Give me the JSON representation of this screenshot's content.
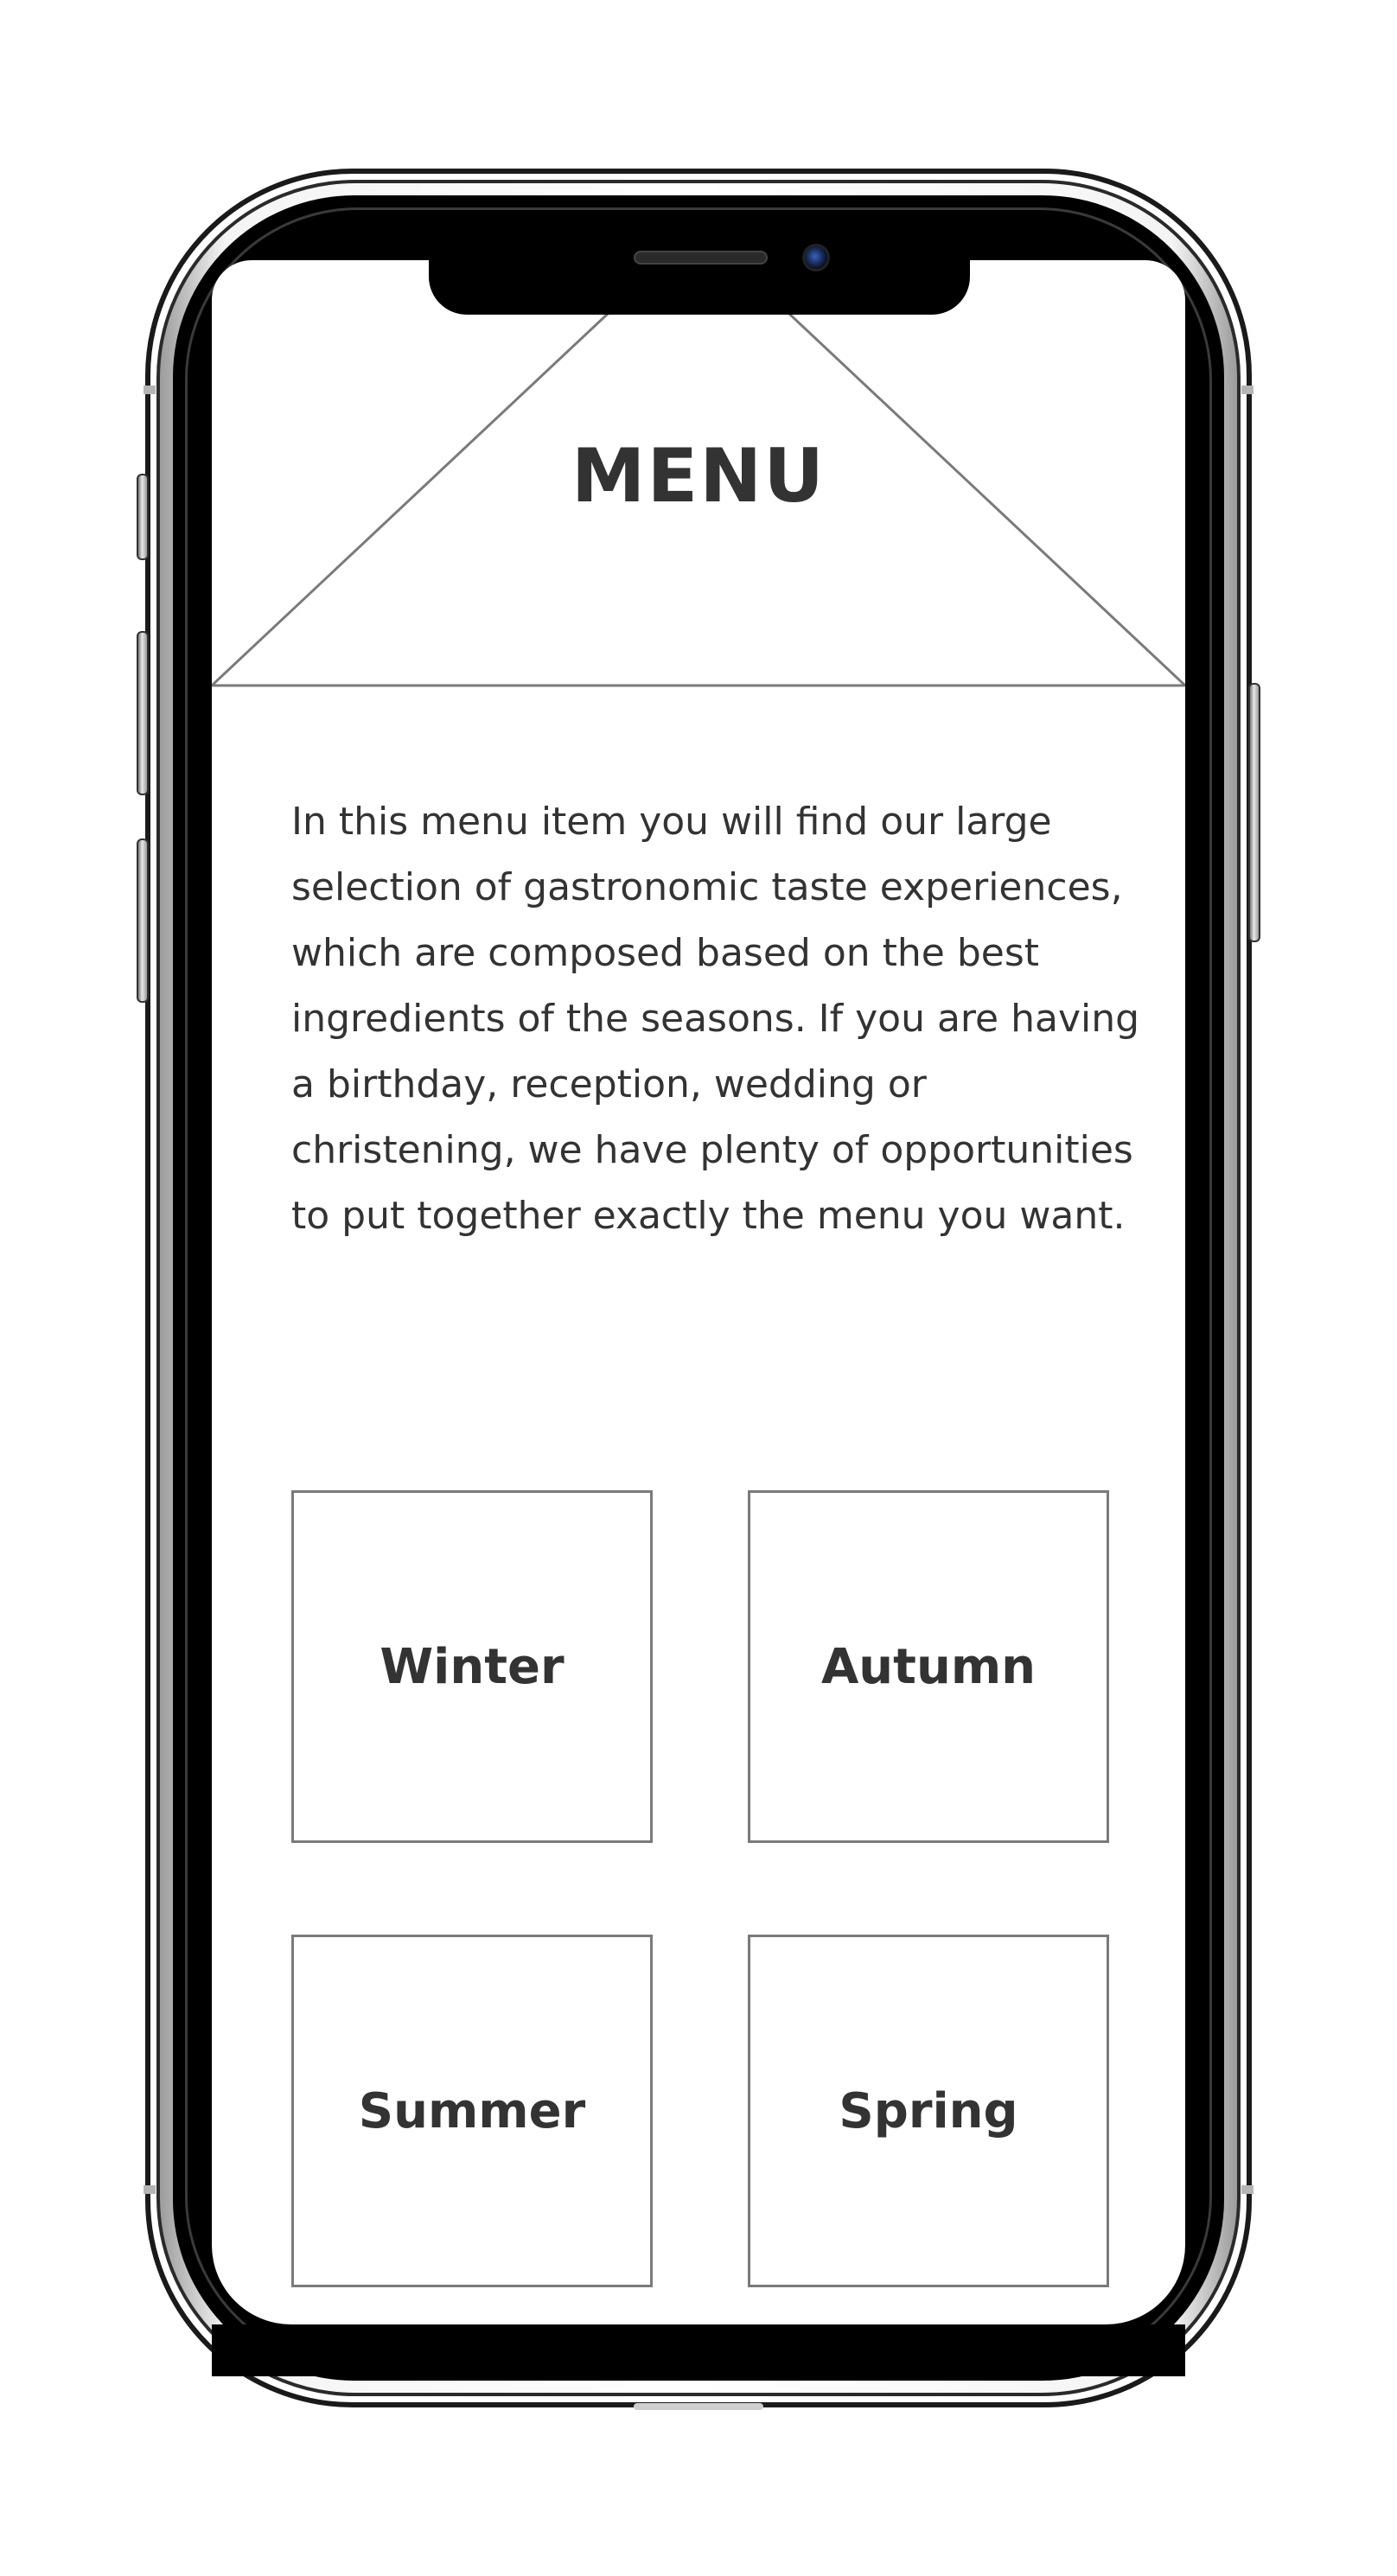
{
  "header": {
    "title": "MENU"
  },
  "intro": {
    "lines": [
      "In this menu item you will find our large",
      "selection of gastronomic taste experiences,",
      "which are composed based on the best",
      "ingredients of the seasons. If you are having",
      "a birthday, reception, wedding or",
      "christening, we have plenty of opportunities",
      "to put together exactly the menu you want."
    ]
  },
  "seasons": [
    {
      "label": "Winter"
    },
    {
      "label": "Autumn"
    },
    {
      "label": "Summer"
    },
    {
      "label": "Spring"
    }
  ],
  "colors": {
    "text": "#333333",
    "wireframe_line": "#7a7a7a",
    "device_body": "#000000"
  }
}
